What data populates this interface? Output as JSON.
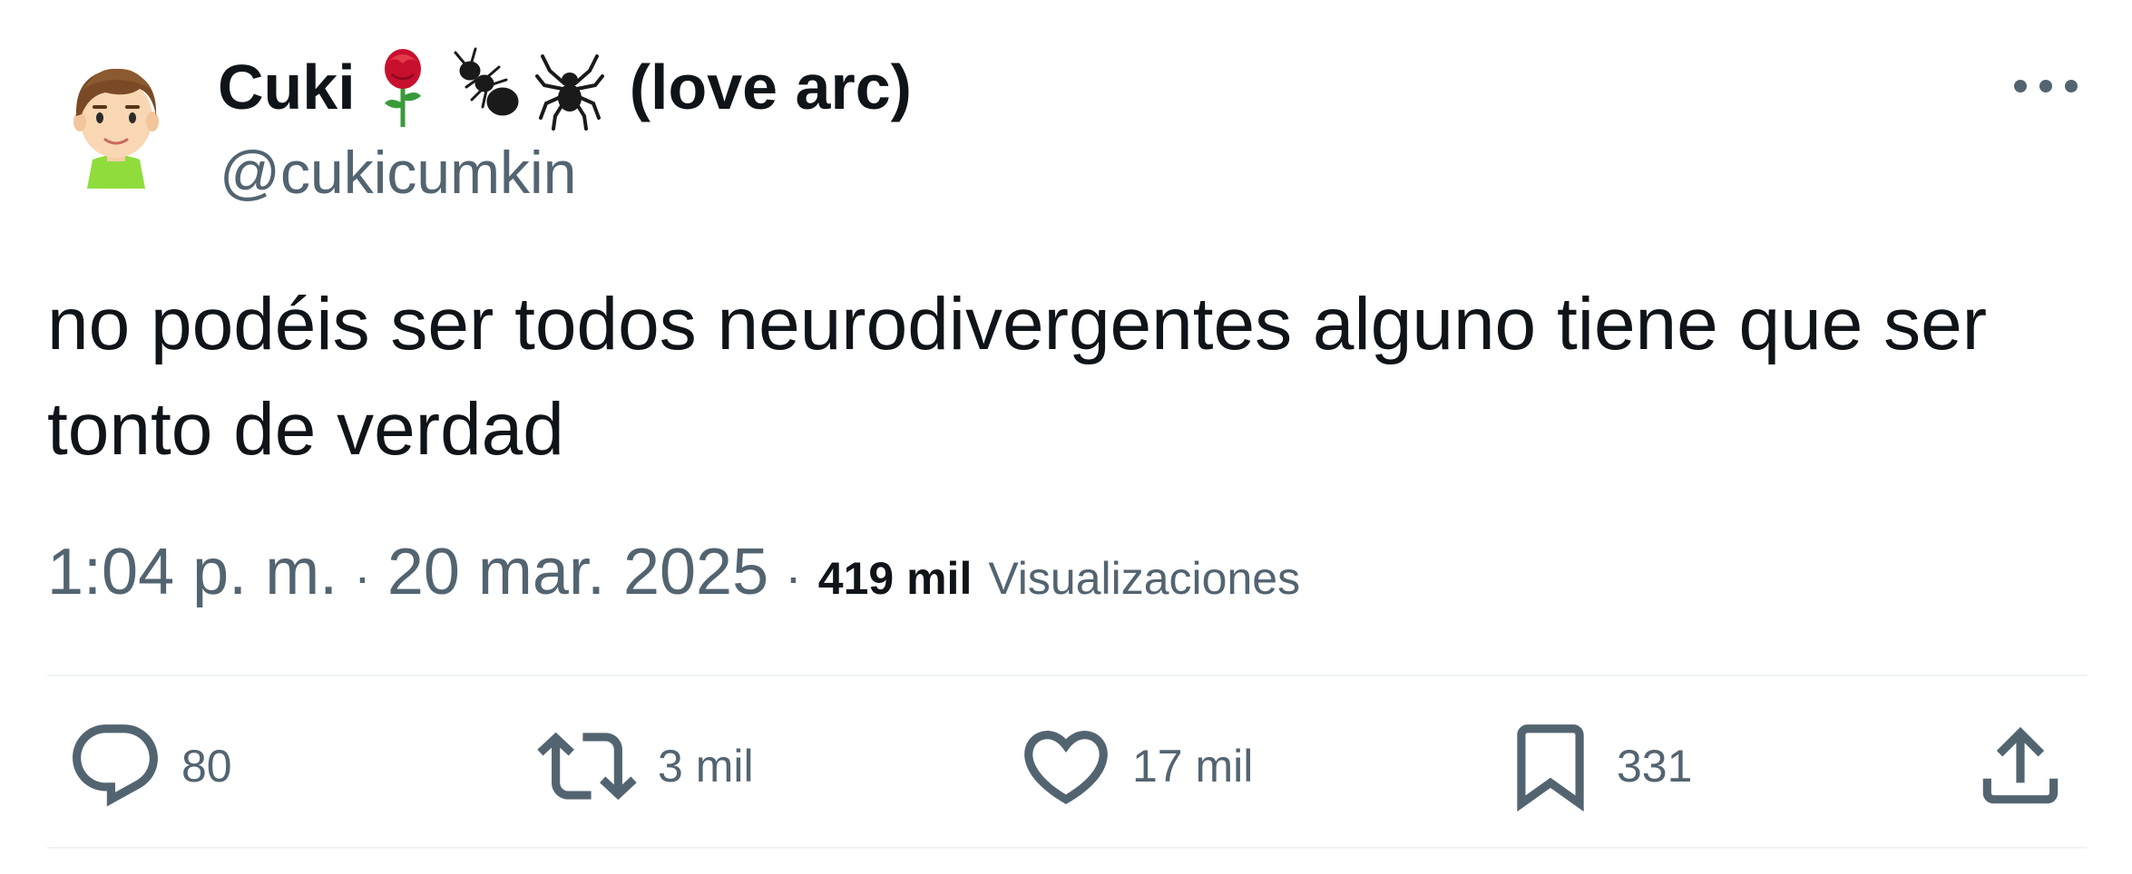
{
  "author": {
    "display_name": "Cuki",
    "name_emojis": [
      "rose-emoji",
      "ant-emoji",
      "spider-emoji"
    ],
    "name_suffix": "(love arc)",
    "handle": "@cukicumkin",
    "avatar_icon": "mii-avatar"
  },
  "tweet": {
    "text": "no podéis ser todos neurodivergentes alguno tiene que ser tonto de verdad",
    "time": "1:04 p. m.",
    "separator": "·",
    "date": "20 mar. 2025",
    "views_count": "419 mil",
    "views_label": "Visualizaciones"
  },
  "actions": {
    "reply_count": "80",
    "retweet_count": "3 mil",
    "like_count": "17 mil",
    "bookmark_count": "331"
  },
  "colors": {
    "text_primary": "#0f1419",
    "text_secondary": "#536471",
    "divider": "#eff3f4"
  }
}
